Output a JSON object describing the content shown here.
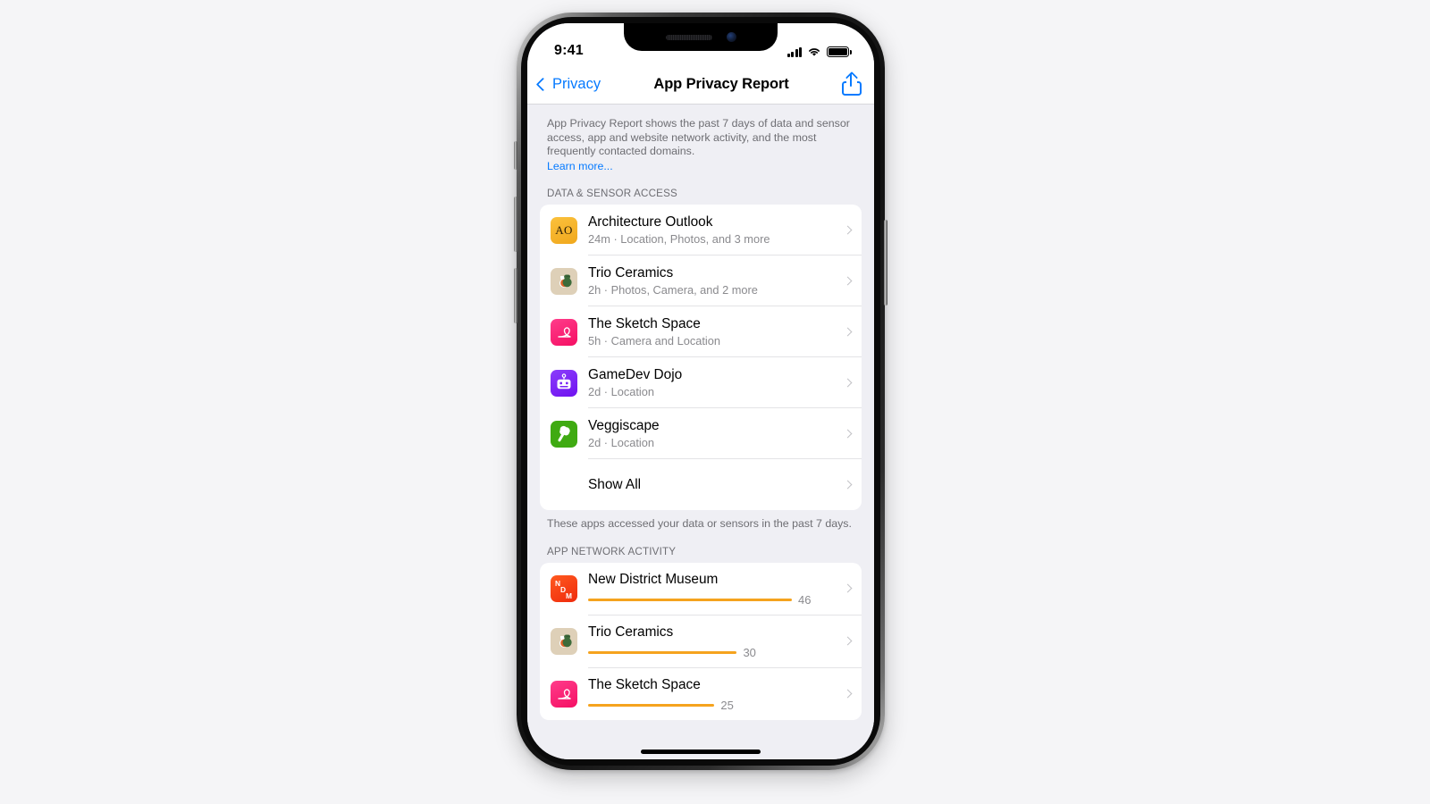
{
  "status_bar": {
    "time": "9:41",
    "signal_icon": "cellular-bars-icon",
    "wifi_icon": "wifi-icon",
    "battery_icon": "battery-full-icon"
  },
  "nav": {
    "back_label": "Privacy",
    "back_icon": "chevron-left-icon",
    "title": "App Privacy Report",
    "share_icon": "share-icon"
  },
  "intro": {
    "text": "App Privacy Report shows the past 7 days of data and sensor access, app and website network activity, and the most frequently contacted domains.",
    "link": "Learn more...",
    "link_color": "#067aff"
  },
  "data_sensor_section": {
    "header": "DATA & SENSOR ACCESS",
    "footnote": "These apps accessed your data or sensors in the past 7 days.",
    "rows": [
      {
        "title": "Architecture Outlook",
        "subtitle": "24m · Location, Photos, and 3 more",
        "icon": "architecture-outlook-icon",
        "icon_text": "AO"
      },
      {
        "title": "Trio Ceramics",
        "subtitle": "2h · Photos, Camera, and 2 more",
        "icon": "trio-ceramics-icon"
      },
      {
        "title": "The Sketch Space",
        "subtitle": "5h · Camera and Location",
        "icon": "sketch-space-icon"
      },
      {
        "title": "GameDev Dojo",
        "subtitle": "2d · Location",
        "icon": "gamedev-dojo-icon"
      },
      {
        "title": "Veggiscape",
        "subtitle": "2d · Location",
        "icon": "veggiscape-icon"
      }
    ],
    "show_all_label": "Show All"
  },
  "network_section": {
    "header": "APP NETWORK ACTIVITY",
    "accent_color": "#f5a31e",
    "rows": [
      {
        "title": "New District Museum",
        "value": "46",
        "pct": 100,
        "icon": "new-district-museum-icon",
        "icon_letters": [
          "N",
          "D",
          "M"
        ]
      },
      {
        "title": "Trio Ceramics",
        "value": "30",
        "pct": 73,
        "icon": "trio-ceramics-icon"
      },
      {
        "title": "The Sketch Space",
        "value": "25",
        "pct": 62,
        "icon": "sketch-space-icon"
      }
    ]
  }
}
